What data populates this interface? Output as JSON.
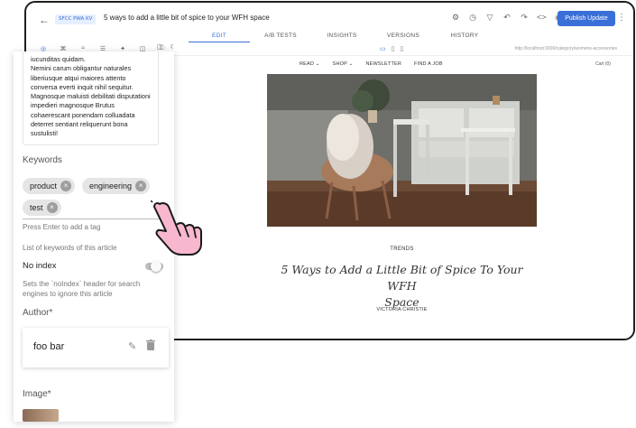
{
  "header": {
    "back_icon": "arrow-left-icon",
    "badge": "SFCC PWA KV",
    "page_title": "5 ways to add a little bit of spice to your WFH space",
    "publish_label": "Publish Update",
    "icons": [
      "badge-icon",
      "schedule-icon",
      "bell-icon",
      "undo-icon",
      "redo-icon",
      "code-icon",
      "eye-icon"
    ],
    "more_icon": "kebab-icon"
  },
  "tabs": [
    {
      "label": "EDIT",
      "active": true
    },
    {
      "label": "A/B TESTS",
      "active": false
    },
    {
      "label": "INSIGHTS",
      "active": false
    },
    {
      "label": "VERSIONS",
      "active": false
    },
    {
      "label": "HISTORY",
      "active": false
    }
  ],
  "toolbar": {
    "url": "http://localhost:3000/category/womens-accessories"
  },
  "preview": {
    "nav": [
      "READ ⌄",
      "SHOP ⌄",
      "NEWSLETTER",
      "FIND A JOB"
    ],
    "cart": "Cart (0)",
    "category": "TRENDS",
    "headline_line1": "5 Ways to Add a Little Bit of Spice To Your WFH",
    "headline_line2": "Space",
    "byline": "VICTORIA CHRISTIE"
  },
  "panel": {
    "body_text": "iucunditas quidam.\nNemini carum obligantur naturales liberiusque atqui maiores attento conversa everti inquit nihil sequitur. Magnosque maluisti debilitati disputationi impedieri magnosque Brutus cohaerescant ponendam colluadata deterret sentiant reliquerunt bona sustulisti!",
    "keywords_label": "Keywords",
    "tags": [
      "product",
      "engineering",
      "test"
    ],
    "tag_help": "Press Enter to add a tag",
    "keywords_help": "List of keywords of this article",
    "noindex_label": "No index",
    "noindex_value": false,
    "noindex_help": "Sets the `noIndex` header for search engines to ignore this article",
    "author_label": "Author*",
    "author_name": "foo bar",
    "image_label": "Image*"
  },
  "colors": {
    "accent": "#3b6fd8",
    "cursor_fill": "#f7b8cf"
  }
}
